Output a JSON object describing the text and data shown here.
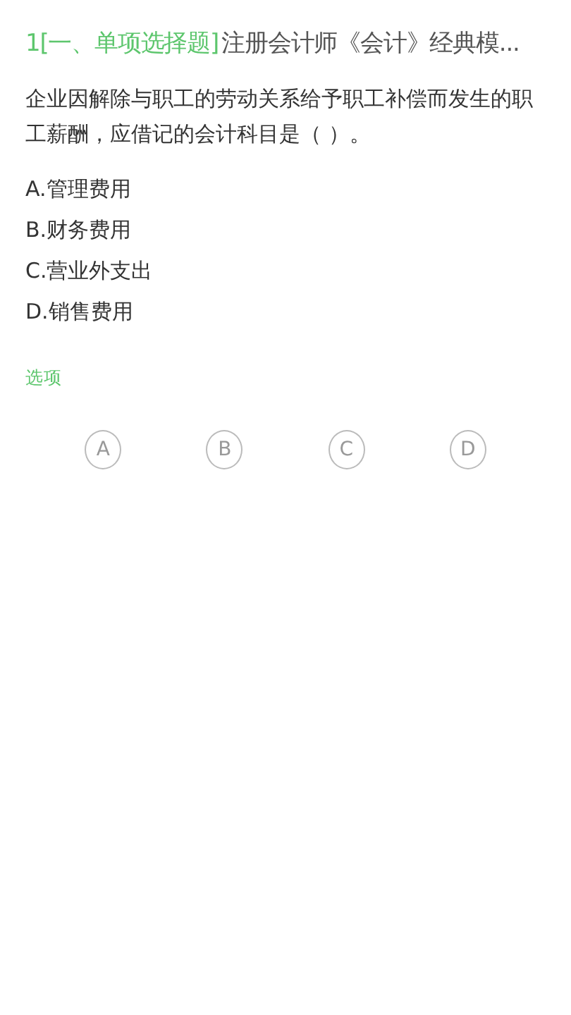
{
  "header": {
    "number_section": "1[一、单项选择题]",
    "title": "注册会计师《会计》经典模..."
  },
  "question": "企业因解除与职工的劳动关系给予职工补偿而发生的职工薪酬，应借记的会计科目是（  ）。",
  "options": [
    "A.管理费用",
    "B.财务费用",
    "C.营业外支出",
    "D.销售费用"
  ],
  "answer_label": "选项",
  "answer_choices": [
    {
      "label": "A",
      "selected": false
    },
    {
      "label": "B",
      "selected": false
    },
    {
      "label": "C",
      "selected": false
    },
    {
      "label": "D",
      "selected": false
    }
  ]
}
